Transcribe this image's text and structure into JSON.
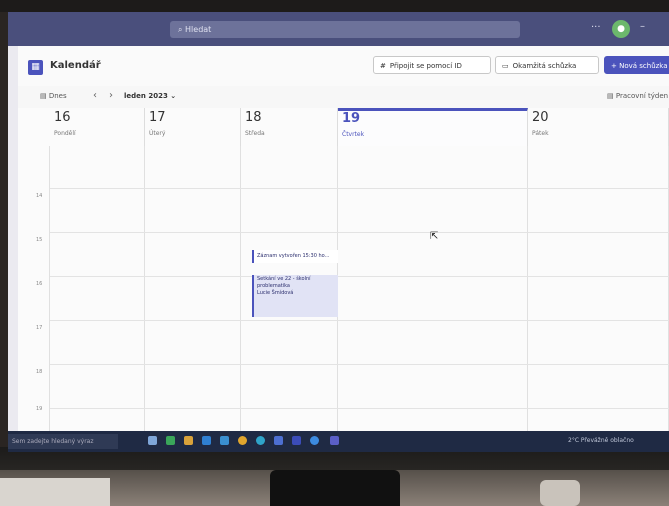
{
  "search": {
    "placeholder": "Hledat"
  },
  "app": {
    "title": "Kalendář"
  },
  "buttons": {
    "join": "Připojit se pomocí ID",
    "meet_now": "Okamžitá schůzka",
    "new_meeting": "+ Nová schůzka"
  },
  "nav": {
    "today": "Dnes",
    "month": "leden 2023",
    "view": "Pracovní týden"
  },
  "days": [
    {
      "num": "16",
      "name": "Pondělí"
    },
    {
      "num": "17",
      "name": "Úterý"
    },
    {
      "num": "18",
      "name": "Středa"
    },
    {
      "num": "19",
      "name": "Čtvrtek"
    },
    {
      "num": "20",
      "name": "Pátek"
    }
  ],
  "hours": [
    "14",
    "15",
    "16",
    "17",
    "18",
    "19"
  ],
  "events": [
    {
      "title": "Záznam vytvořen 15:30 ho..."
    },
    {
      "title": "Setkání ve 22 - školní",
      "line2": "problematika",
      "organizer": "Lucie Šmídová"
    }
  ],
  "taskbar": {
    "search": "Sem zadejte hledaný výraz",
    "tray": "2°C Převážně oblačno"
  },
  "colors": {
    "accent": "#4b53bc",
    "titlebar": "#4a4f7c",
    "taskbar": "#1f2a44"
  }
}
